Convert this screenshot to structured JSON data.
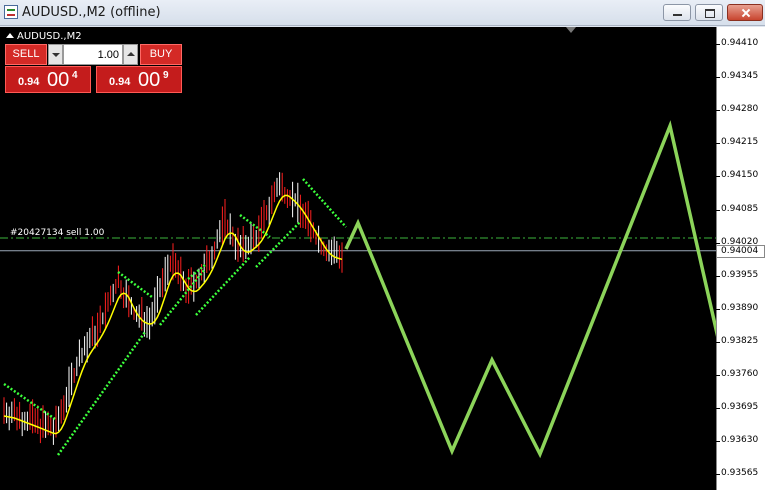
{
  "window": {
    "title": "AUDUSD.,M2 (offline)"
  },
  "chart": {
    "symbol_label": "AUDUSD.,M2",
    "order_label": "#20427134 sell 1.00"
  },
  "trade_panel": {
    "sell_label": "SELL",
    "buy_label": "BUY",
    "volume": "1.00",
    "sell_price": {
      "prefix": "0.94",
      "big": "00",
      "sup": "4"
    },
    "buy_price": {
      "prefix": "0.94",
      "big": "00",
      "sup": "9"
    }
  },
  "price_axis": {
    "ticks": [
      "0.94410",
      "0.94345",
      "0.94280",
      "0.94215",
      "0.94150",
      "0.94085",
      "0.94020",
      "0.93955",
      "0.93890",
      "0.93825",
      "0.93760",
      "0.93695",
      "0.93630",
      "0.93565"
    ],
    "current_price": "0.94004"
  },
  "colors": {
    "background": "#000000",
    "bull_candle": "#ffffff",
    "bear_candle": "#ff2020",
    "moving_average": "#ffff00",
    "channel_dots": "#3cff3c",
    "forecast_line": "#8cd45a",
    "order_line": "#3cb43c"
  }
}
